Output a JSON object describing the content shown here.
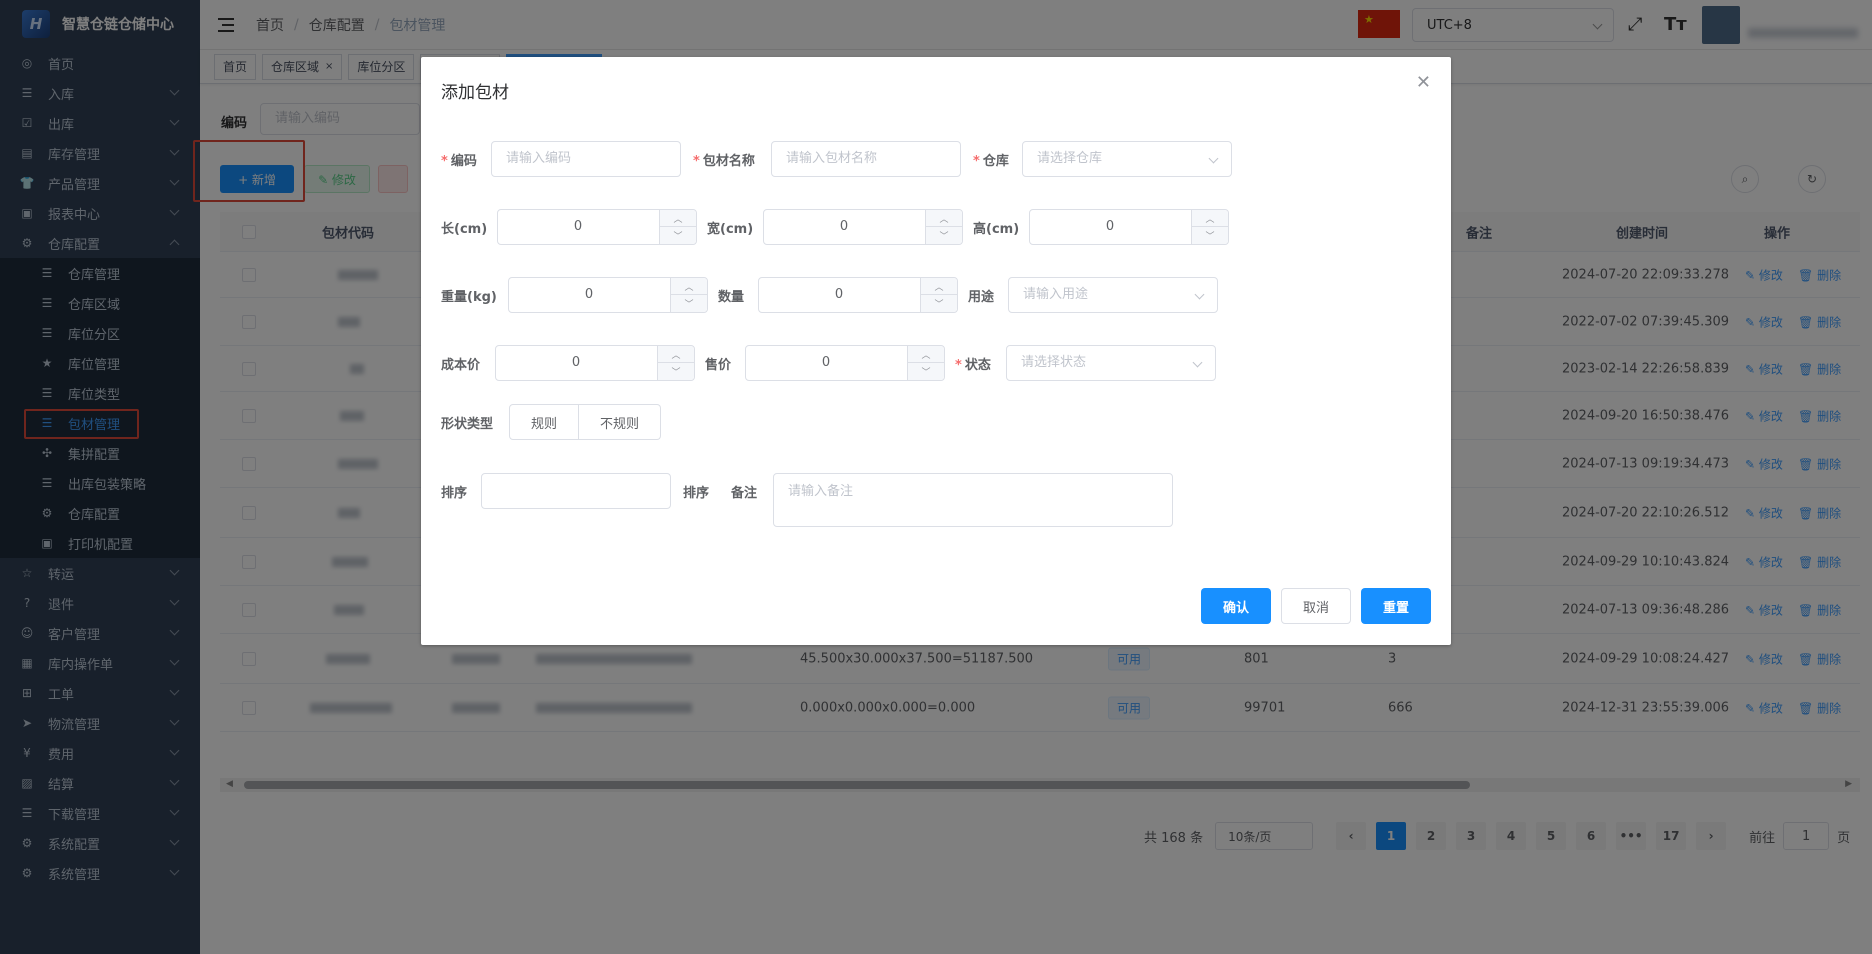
{
  "sidebar": {
    "logo_text": "智慧仓链仓储中心",
    "items": [
      {
        "label": "首页",
        "icon": "dashboard-icon"
      },
      {
        "label": "入库",
        "icon": "list-icon"
      },
      {
        "label": "出库",
        "icon": "checkbox-icon"
      },
      {
        "label": "库存管理",
        "icon": "inventory-icon"
      },
      {
        "label": "产品管理",
        "icon": "shirt-icon"
      },
      {
        "label": "报表中心",
        "icon": "report-icon"
      },
      {
        "label": "仓库配置",
        "icon": "gear-icon"
      }
    ],
    "sub_items": [
      {
        "label": "仓库管理"
      },
      {
        "label": "仓库区域"
      },
      {
        "label": "库位分区"
      },
      {
        "label": "库位管理"
      },
      {
        "label": "库位类型"
      },
      {
        "label": "包材管理"
      },
      {
        "label": "集拼配置"
      },
      {
        "label": "出库包装策略"
      },
      {
        "label": "仓库配置"
      },
      {
        "label": "打印机配置"
      }
    ],
    "items_after": [
      {
        "label": "转运"
      },
      {
        "label": "退件"
      },
      {
        "label": "客户管理"
      },
      {
        "label": "库内操作单"
      },
      {
        "label": "工单"
      },
      {
        "label": "物流管理"
      },
      {
        "label": "费用"
      },
      {
        "label": "结算"
      },
      {
        "label": "下载管理"
      },
      {
        "label": "系统配置"
      },
      {
        "label": "系统管理"
      }
    ]
  },
  "navbar": {
    "breadcrumb": [
      "首页",
      "仓库配置",
      "包材管理"
    ],
    "timezone": "UTC+8",
    "flag_glyph": "★"
  },
  "tags": [
    "首页",
    "仓库区域",
    "库位分区"
  ],
  "tag_close": "×",
  "query": {
    "label": "编码",
    "placeholder": "请输入编码"
  },
  "toolbar": {
    "add_label": "+ 新增",
    "edit_label": "✎ 修改"
  },
  "table": {
    "headers": {
      "code": "包材代码",
      "remark": "备注",
      "created": "创建时间",
      "ops": "操作"
    },
    "rows": [
      {
        "created": "2024-07-20 22:09:33.278"
      },
      {
        "created": "2022-07-02 07:39:45.309"
      },
      {
        "created": "2023-02-14 22:26:58.839"
      },
      {
        "created": "2024-09-20 16:50:38.476"
      },
      {
        "created": "2024-07-13 09:19:34.473"
      },
      {
        "created": "2024-07-20 22:10:26.512"
      },
      {
        "created": "2024-09-29 10:10:43.824"
      },
      {
        "created": "2024-07-13 09:36:48.286"
      },
      {
        "created": "2024-09-29 10:08:24.427",
        "dims": "45.500x30.000x37.500=51187.500",
        "status": "可用",
        "qty": "801",
        "sort": "3"
      },
      {
        "created": "2024-12-31 23:55:39.006",
        "dims": "0.000x0.000x0.000=0.000",
        "status": "可用",
        "qty": "99701",
        "sort": "666"
      }
    ],
    "edit_op": "修改",
    "delete_op": "删除"
  },
  "pagination": {
    "total": "共 168 条",
    "page_size": "10条/页",
    "pages": [
      "1",
      "2",
      "3",
      "4",
      "5",
      "6",
      "•••",
      "17"
    ],
    "goto": "前往",
    "goto_value": "1",
    "page_suffix": "页"
  },
  "dialog": {
    "title": "添加包材",
    "fields": {
      "code": {
        "label": "编码",
        "placeholder": "请输入编码"
      },
      "name": {
        "label": "包材名称",
        "placeholder": "请输入包材名称"
      },
      "warehouse": {
        "label": "仓库",
        "placeholder": "请选择仓库"
      },
      "length": {
        "label": "长(cm)",
        "value": "0"
      },
      "width": {
        "label": "宽(cm)",
        "value": "0"
      },
      "height": {
        "label": "高(cm)",
        "value": "0"
      },
      "weight": {
        "label": "重量(kg)",
        "value": "0"
      },
      "quantity": {
        "label": "数量",
        "value": "0"
      },
      "usage": {
        "label": "用途",
        "placeholder": "请输入用途"
      },
      "cost": {
        "label": "成本价",
        "value": "0"
      },
      "price": {
        "label": "售价",
        "value": "0"
      },
      "status": {
        "label": "状态",
        "placeholder": "请选择状态"
      },
      "shape": {
        "label": "形状类型",
        "options": [
          "规则",
          "不规则"
        ]
      },
      "sort": {
        "label": "排序",
        "suffix": "排序"
      },
      "remark": {
        "label": "备注",
        "placeholder": "请输入备注"
      }
    },
    "buttons": {
      "confirm": "确认",
      "cancel": "取消",
      "reset": "重置"
    }
  },
  "colors": {
    "primary": "#1890ff",
    "sidebar": "#304156",
    "highlight": "#e04b3a"
  }
}
